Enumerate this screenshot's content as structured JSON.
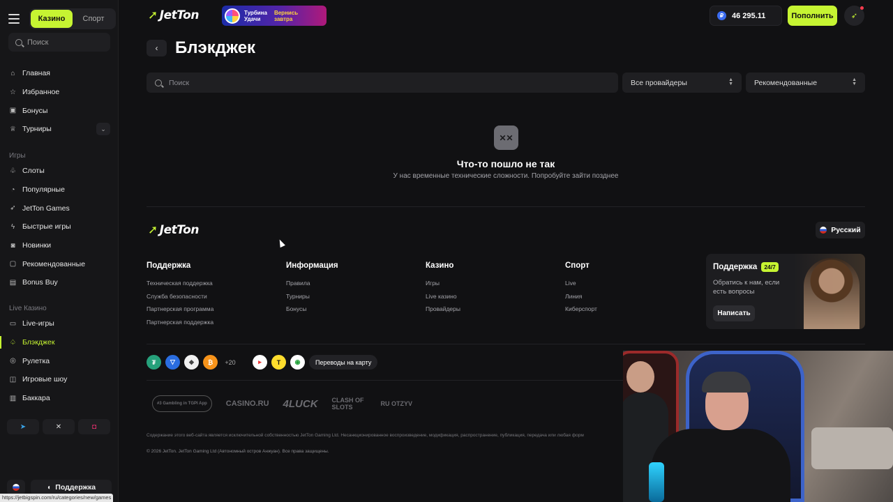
{
  "sidebar": {
    "mode_tabs": [
      "Казино",
      "Спорт"
    ],
    "search_placeholder": "Поиск",
    "main_items": [
      {
        "label": "Главная",
        "icon": "home-icon"
      },
      {
        "label": "Избранное",
        "icon": "star-icon"
      },
      {
        "label": "Бонусы",
        "icon": "gift-icon"
      },
      {
        "label": "Турниры",
        "icon": "trophy-icon"
      }
    ],
    "games_heading": "Игры",
    "games_items": [
      {
        "label": "Слоты",
        "icon": "slots-icon"
      },
      {
        "label": "Популярные",
        "icon": "fire-icon"
      },
      {
        "label": "JetTon Games",
        "icon": "jet-icon"
      },
      {
        "label": "Быстрые игры",
        "icon": "lightning-icon"
      },
      {
        "label": "Новинки",
        "icon": "new-icon"
      },
      {
        "label": "Рекомендованные",
        "icon": "thumbs-icon"
      },
      {
        "label": "Bonus Buy",
        "icon": "cart-icon"
      }
    ],
    "live_heading": "Live Казино",
    "live_items": [
      {
        "label": "Live-игры",
        "icon": "live-icon"
      },
      {
        "label": "Блэкджек",
        "icon": "spade-icon",
        "active": true
      },
      {
        "label": "Рулетка",
        "icon": "roulette-icon"
      },
      {
        "label": "Игровые шоу",
        "icon": "show-icon"
      },
      {
        "label": "Баккара",
        "icon": "cards-icon"
      }
    ],
    "support_label": "Поддержка"
  },
  "header": {
    "logo_text": "JetTon",
    "banner_line1": "Турбина",
    "banner_line2": "Удачи",
    "banner_line3": "Вернись",
    "banner_line4": "завтра",
    "balance": "46 295.11",
    "topup_label": "Пополнить"
  },
  "page": {
    "title": "Блэкджек",
    "search_placeholder": "Поиск",
    "providers_select": "Все провайдеры",
    "sort_select": "Рекомендованные"
  },
  "error": {
    "title": "Что-то пошло не так",
    "subtitle": "У нас временные технические сложности. Попробуйте зайти позднее"
  },
  "footer": {
    "logo_text": "JetTon",
    "language": "Русский",
    "columns": [
      {
        "heading": "Поддержка",
        "links": [
          "Техническая поддержка",
          "Служба безопасности",
          "Партнерская программа",
          "Партнерская поддержка"
        ]
      },
      {
        "heading": "Информация",
        "links": [
          "Правила",
          "Турниры",
          "Бонусы"
        ]
      },
      {
        "heading": "Казино",
        "links": [
          "Игры",
          "Live казино",
          "Провайдеры"
        ]
      },
      {
        "heading": "Спорт",
        "links": [
          "Live",
          "Линия",
          "Киберспорт"
        ]
      }
    ],
    "support_card": {
      "title": "Поддержка",
      "badge": "24/7",
      "text": "Обратись к нам, если есть вопросы",
      "button": "Написать"
    },
    "payments_more": "+20",
    "card_transfer": "Переводы на карту",
    "partners": [
      "#3 Gambling in TGPI App",
      "CASINO.RU",
      "4LUCK",
      "CLASH OF SLOTS",
      "RU OTZYV"
    ],
    "legal": "Содержание этого веб-сайта является исключительной собственностью JetTon Gaming Ltd. Несанкционированное воспроизведение, модификация, распространение, публикация, передача или любая форм",
    "copyright": "© 2026 JetTon. JetTon Gaming Ltd (Автономный остров Анжуан). Все права защищены."
  },
  "status_url": "https://jetbigspin.com/ru/categories/new/games",
  "colors": {
    "accent": "#c6f432",
    "background": "#111113",
    "sidebar": "#161618"
  }
}
